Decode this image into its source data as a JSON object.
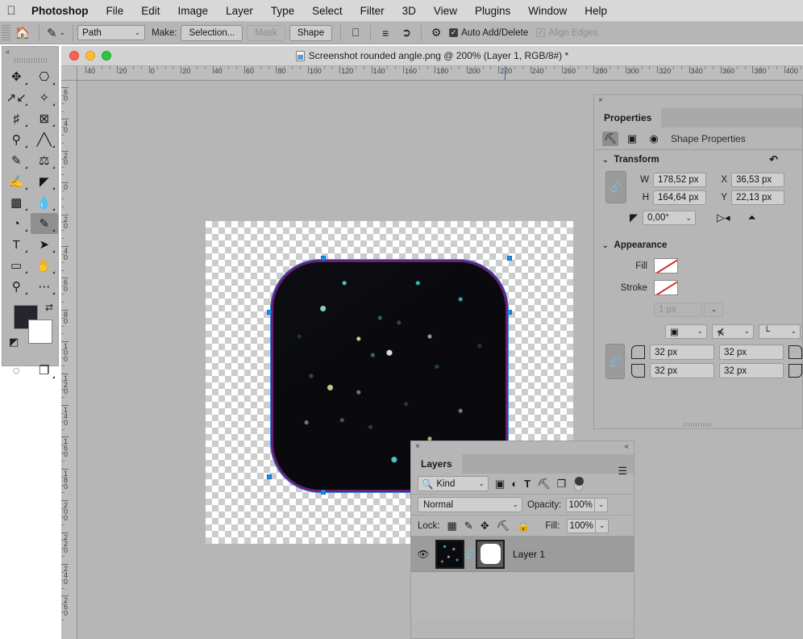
{
  "menubar": {
    "apple_icon": "apple-logo",
    "items": [
      {
        "label": "Photoshop",
        "bold": true
      },
      {
        "label": "File"
      },
      {
        "label": "Edit"
      },
      {
        "label": "Image"
      },
      {
        "label": "Layer"
      },
      {
        "label": "Type"
      },
      {
        "label": "Select"
      },
      {
        "label": "Filter"
      },
      {
        "label": "3D"
      },
      {
        "label": "View"
      },
      {
        "label": "Plugins"
      },
      {
        "label": "Window"
      },
      {
        "label": "Help"
      }
    ]
  },
  "options_bar": {
    "home_icon": "home-icon",
    "tool_icon": "pen-tool-icon",
    "tool_preset_caret": "⌄",
    "mode_select": {
      "value": "Path",
      "caret": "⌄"
    },
    "make_label": "Make:",
    "selection_button": "Selection...",
    "mask_button": "Mask",
    "shape_button": "Shape",
    "path_operations_icon": "path-operations-icon",
    "path_alignment_icon": "path-alignment-icon",
    "path_arrangement_icon": "path-arrangement-icon",
    "settings_icon": "gear-icon",
    "auto_add_delete": {
      "label": "Auto Add/Delete",
      "checked": true
    },
    "align_edges": {
      "label": "Align Edges",
      "checked": false,
      "disabled": true
    }
  },
  "toolbox": {
    "collapse_icon": "«",
    "tools": [
      {
        "name": "move-tool",
        "glyph": "✥",
        "active": false
      },
      {
        "name": "rectangular-marquee-tool",
        "glyph": "▭",
        "active": false
      },
      {
        "name": "lasso-tool",
        "glyph": "𝒫",
        "active": false
      },
      {
        "name": "object-selection-tool",
        "glyph": "✨",
        "active": false
      },
      {
        "name": "crop-tool",
        "glyph": "⌗",
        "active": false
      },
      {
        "name": "frame-tool",
        "glyph": "⊠",
        "active": false
      },
      {
        "name": "eyedropper-tool",
        "glyph": "⚲",
        "active": false
      },
      {
        "name": "healing-brush-tool",
        "glyph": "🩹",
        "active": false
      },
      {
        "name": "brush-tool",
        "glyph": "✎",
        "active": false
      },
      {
        "name": "clone-stamp-tool",
        "glyph": "⊥",
        "active": false
      },
      {
        "name": "history-brush-tool",
        "glyph": "🖌",
        "active": false
      },
      {
        "name": "eraser-tool",
        "glyph": "◣",
        "active": false
      },
      {
        "name": "gradient-tool",
        "glyph": "▥",
        "active": false
      },
      {
        "name": "blur-tool",
        "glyph": "💧",
        "active": false
      },
      {
        "name": "dodge-tool",
        "glyph": "◔",
        "active": false
      },
      {
        "name": "pen-tool",
        "glyph": "✒",
        "active": true
      },
      {
        "name": "type-tool",
        "glyph": "T",
        "active": false
      },
      {
        "name": "path-selection-tool",
        "glyph": "➤",
        "active": false
      },
      {
        "name": "rectangle-tool",
        "glyph": "▢",
        "active": false
      },
      {
        "name": "hand-tool",
        "glyph": "✋",
        "active": false
      },
      {
        "name": "zoom-tool",
        "glyph": "⌕",
        "active": false
      },
      {
        "name": "more-tools",
        "glyph": "•••",
        "active": false
      }
    ],
    "foreground_color": "#27242e",
    "background_color": "#ffffff",
    "swap_icon": "⇄",
    "default_colors_icon": "◩",
    "quick_mask_icon": "◌",
    "screen_mode_icon": "❐"
  },
  "document": {
    "title": "Screenshot rounded angle.png @ 200% (Layer 1, RGB/8#) *",
    "doc_icon": "document-thumbnail-icon",
    "traffic_lights": [
      "close",
      "minimize",
      "zoom"
    ],
    "zoom_level": "200%",
    "ruler_h": [
      "40",
      "20",
      "0",
      "20",
      "40",
      "60",
      "80",
      "100",
      "120",
      "140",
      "160",
      "180",
      "200",
      "220",
      "240",
      "260",
      "280",
      "300",
      "320",
      "340",
      "360",
      "380",
      "400"
    ],
    "ruler_v": [
      "60",
      "40",
      "20",
      "0",
      "20",
      "40",
      "60",
      "80",
      "100",
      "120",
      "140",
      "160",
      "180",
      "200",
      "220",
      "240",
      "260"
    ]
  },
  "properties": {
    "close_icon": "×",
    "tab_label": "Properties",
    "mode_icons": [
      {
        "name": "shape-properties-icon",
        "glyph": "⛶",
        "active": true
      },
      {
        "name": "image-properties-icon",
        "glyph": "🖼",
        "active": false
      },
      {
        "name": "adjustment-properties-icon",
        "glyph": "◑",
        "active": false
      }
    ],
    "header_label": "Shape Properties",
    "transform": {
      "title": "Transform",
      "chevron": "⌄",
      "reset_icon": "reset-icon",
      "link_icon": "🔗",
      "w_label": "W",
      "w_value": "178,52 px",
      "x_label": "X",
      "x_value": "36,53 px",
      "h_label": "H",
      "h_value": "164,64 px",
      "y_label": "Y",
      "y_value": "22,13 px",
      "angle_icon": "angle-icon",
      "angle_value": "0,00°",
      "angle_caret": "⌄",
      "flip_h_icon": "flip-horizontal-icon",
      "flip_v_icon": "flip-vertical-icon"
    },
    "appearance": {
      "title": "Appearance",
      "chevron": "⌄",
      "fill_label": "Fill",
      "fill_value": "none",
      "stroke_label": "Stroke",
      "stroke_value": "none",
      "stroke_width": "1 px",
      "stroke_width_caret": "⌄",
      "stroke_align_icon": "stroke-align-icon",
      "stroke_cap_icon": "stroke-cap-icon",
      "stroke_corner_icon": "stroke-corner-icon",
      "corner_link_icon": "🔗",
      "corner_tl": "32 px",
      "corner_tr": "32 px",
      "corner_bl": "32 px",
      "corner_br": "32 px"
    }
  },
  "layers_panel": {
    "close_icon": "×",
    "collapse_icon": "«",
    "tab_label": "Layers",
    "menu_icon": "panel-menu-icon",
    "filter": {
      "search_icon": "search-icon",
      "kind_label": "Kind",
      "caret": "⌄",
      "pixel_icon": "pixel-layer-filter-icon",
      "adjustment_icon": "adjustment-layer-filter-icon",
      "type_icon": "T",
      "shape_icon": "shape-layer-filter-icon",
      "smart_icon": "smart-object-filter-icon",
      "toggle_name": "filter-toggle"
    },
    "blend": {
      "mode": "Normal",
      "caret": "⌄",
      "opacity_label": "Opacity:",
      "opacity_value": "100%"
    },
    "lock": {
      "label": "Lock:",
      "icons": [
        {
          "name": "lock-transparent-pixels-icon",
          "glyph": "▞"
        },
        {
          "name": "lock-image-pixels-icon",
          "glyph": "🖌"
        },
        {
          "name": "lock-position-icon",
          "glyph": "✥"
        },
        {
          "name": "lock-artboard-nesting-icon",
          "glyph": "⌗"
        },
        {
          "name": "lock-all-icon",
          "glyph": "🔒"
        }
      ],
      "fill_label": "Fill:",
      "fill_value": "100%"
    },
    "layers": [
      {
        "name": "Layer 1",
        "visible": true,
        "eye_icon": "eye-icon",
        "link_icon": "link-icon",
        "has_vector_mask": true
      }
    ]
  }
}
